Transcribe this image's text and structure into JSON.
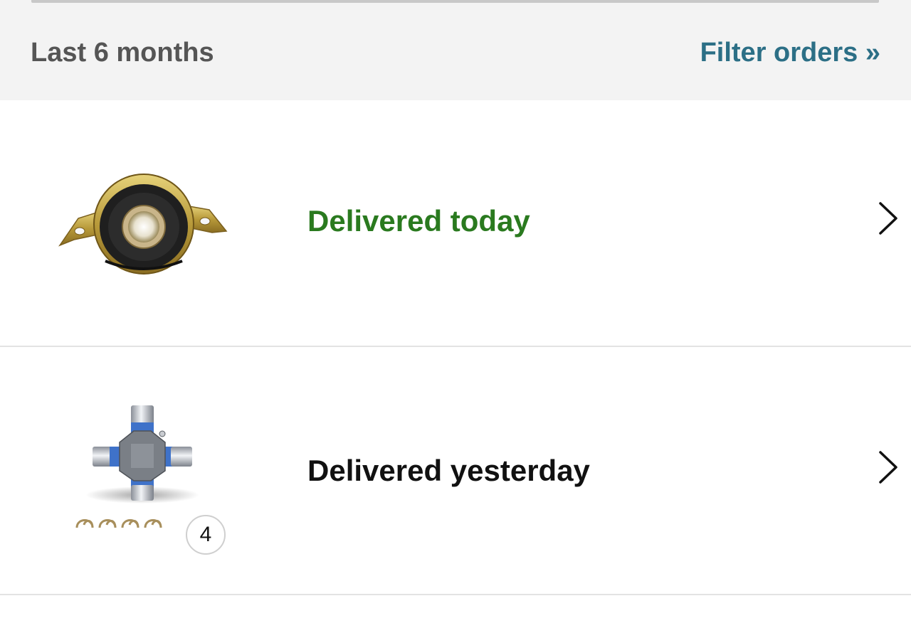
{
  "header": {
    "range_label": "Last 6 months",
    "filter_label": "Filter orders »"
  },
  "orders": [
    {
      "status": "Delivered today",
      "status_color": "#2a7a1f",
      "thumbnail": "center-support-bearing-image",
      "chevron": "chevron-right-icon"
    },
    {
      "status": "Delivered yesterday",
      "status_color": "#111111",
      "thumbnail": "universal-joint-image",
      "quantity_badge": "4",
      "chevron": "chevron-right-icon"
    }
  ],
  "colors": {
    "link": "#2c6f86",
    "header_bg": "#f3f3f3",
    "divider": "#e3e3e3"
  }
}
